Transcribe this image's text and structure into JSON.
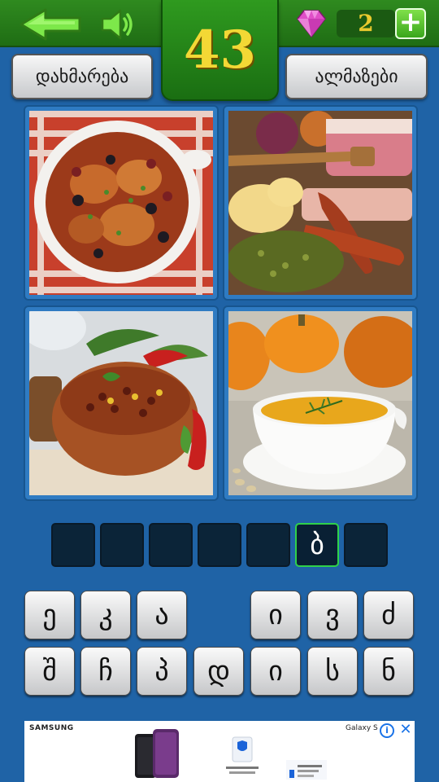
{
  "header": {
    "back_icon": "back-arrow-icon",
    "sound_icon": "speaker-icon",
    "level": "43",
    "gem_icon": "diamond-icon",
    "gem_count": "2",
    "add_gems_label": "+"
  },
  "buttons": {
    "help_label": "დახმარება",
    "diamonds_label": "ალმაზები"
  },
  "pictures": [
    {
      "subject": "chicken-stew-icon"
    },
    {
      "subject": "sausages-meat-icon"
    },
    {
      "subject": "chili-bean-bowl-icon"
    },
    {
      "subject": "pumpkin-soup-icon"
    }
  ],
  "answer_slots": [
    "",
    "",
    "",
    "",
    "",
    "ბ",
    ""
  ],
  "keyboard": {
    "row1": [
      "ე",
      "კ",
      "ა",
      "",
      "ი",
      "ვ",
      "ძ"
    ],
    "row2": [
      "შ",
      "ჩ",
      "პ",
      "დ",
      "ი",
      "ს",
      "ნ"
    ]
  },
  "ad": {
    "brand": "SAMSUNG",
    "product": "Galaxy S",
    "info_label": "i",
    "close_label": "✕"
  },
  "colors": {
    "background": "#1f63a6",
    "top_bar": "#2f8a1f",
    "level_text": "#f3d835",
    "filled_slot_border": "#2fd14a"
  }
}
